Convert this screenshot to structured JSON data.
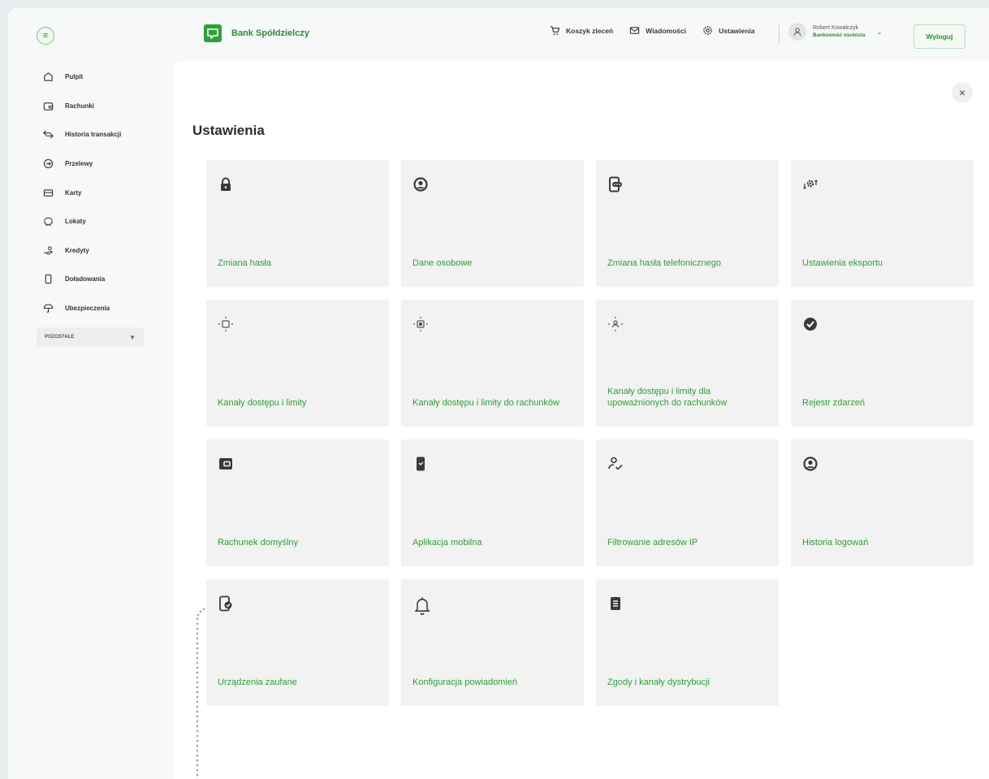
{
  "header": {
    "brand": "Bank Spółdzielczy",
    "nav": [
      {
        "label": "Koszyk zleceń",
        "icon": "cart-icon"
      },
      {
        "label": "Wiadomości",
        "icon": "envelope-icon"
      },
      {
        "label": "Ustawienia",
        "icon": "gear-icon"
      }
    ],
    "user_name": "Robert Kowalczyk",
    "user_role": "Bankowość osobista",
    "logout": "Wyloguj"
  },
  "sidebar": {
    "items": [
      {
        "label": "Pulpit",
        "icon": "home-icon"
      },
      {
        "label": "Rachunki",
        "icon": "wallet-icon"
      },
      {
        "label": "Historia transakcji",
        "icon": "transfer-arrows-icon"
      },
      {
        "label": "Przelewy",
        "icon": "arrow-circle-icon"
      },
      {
        "label": "Karty",
        "icon": "card-icon"
      },
      {
        "label": "Lokaty",
        "icon": "piggy-bank-icon"
      },
      {
        "label": "Kredyty",
        "icon": "hand-money-icon"
      },
      {
        "label": "Doładowania",
        "icon": "phone-icon"
      },
      {
        "label": "Ubezpieczenia",
        "icon": "umbrella-icon"
      }
    ],
    "more_label": "POZOSTAŁE"
  },
  "main": {
    "title": "Ustawienia",
    "tiles": [
      {
        "label": "Zmiana hasła",
        "icon": "lock-icon"
      },
      {
        "label": "Dane osobowe",
        "icon": "user-circle-icon"
      },
      {
        "label": "Zmiana hasła telefonicznego",
        "icon": "phone-password-icon"
      },
      {
        "label": "Ustawienia eksportu",
        "icon": "export-settings-icon"
      },
      {
        "label": "Kanały dostępu i limity",
        "icon": "access-channel-icon"
      },
      {
        "label": "Kanały dostępu i limity do rachunków",
        "icon": "account-channel-icon"
      },
      {
        "label": "Kanały dostępu i limity dla upoważnionych do rachunków",
        "icon": "authorized-channel-icon"
      },
      {
        "label": "Rejestr zdarzeń",
        "icon": "check-circle-icon"
      },
      {
        "label": "Rachunek domyślny",
        "icon": "default-wallet-icon"
      },
      {
        "label": "Aplikacja mobilna",
        "icon": "mobile-app-icon"
      },
      {
        "label": "Filtrowanie adresów IP",
        "icon": "user-check-icon"
      },
      {
        "label": "Historia logowań",
        "icon": "user-circle-icon"
      },
      {
        "label": "Urządzenia zaufane",
        "icon": "trusted-device-icon"
      },
      {
        "label": "Konfiguracja powiadomień",
        "icon": "bell-icon"
      },
      {
        "label": "Zgody i kanały dystrybucji",
        "icon": "document-icon"
      }
    ]
  },
  "colors": {
    "accent": "#2e9e37",
    "tile": "#f2f2f2"
  }
}
